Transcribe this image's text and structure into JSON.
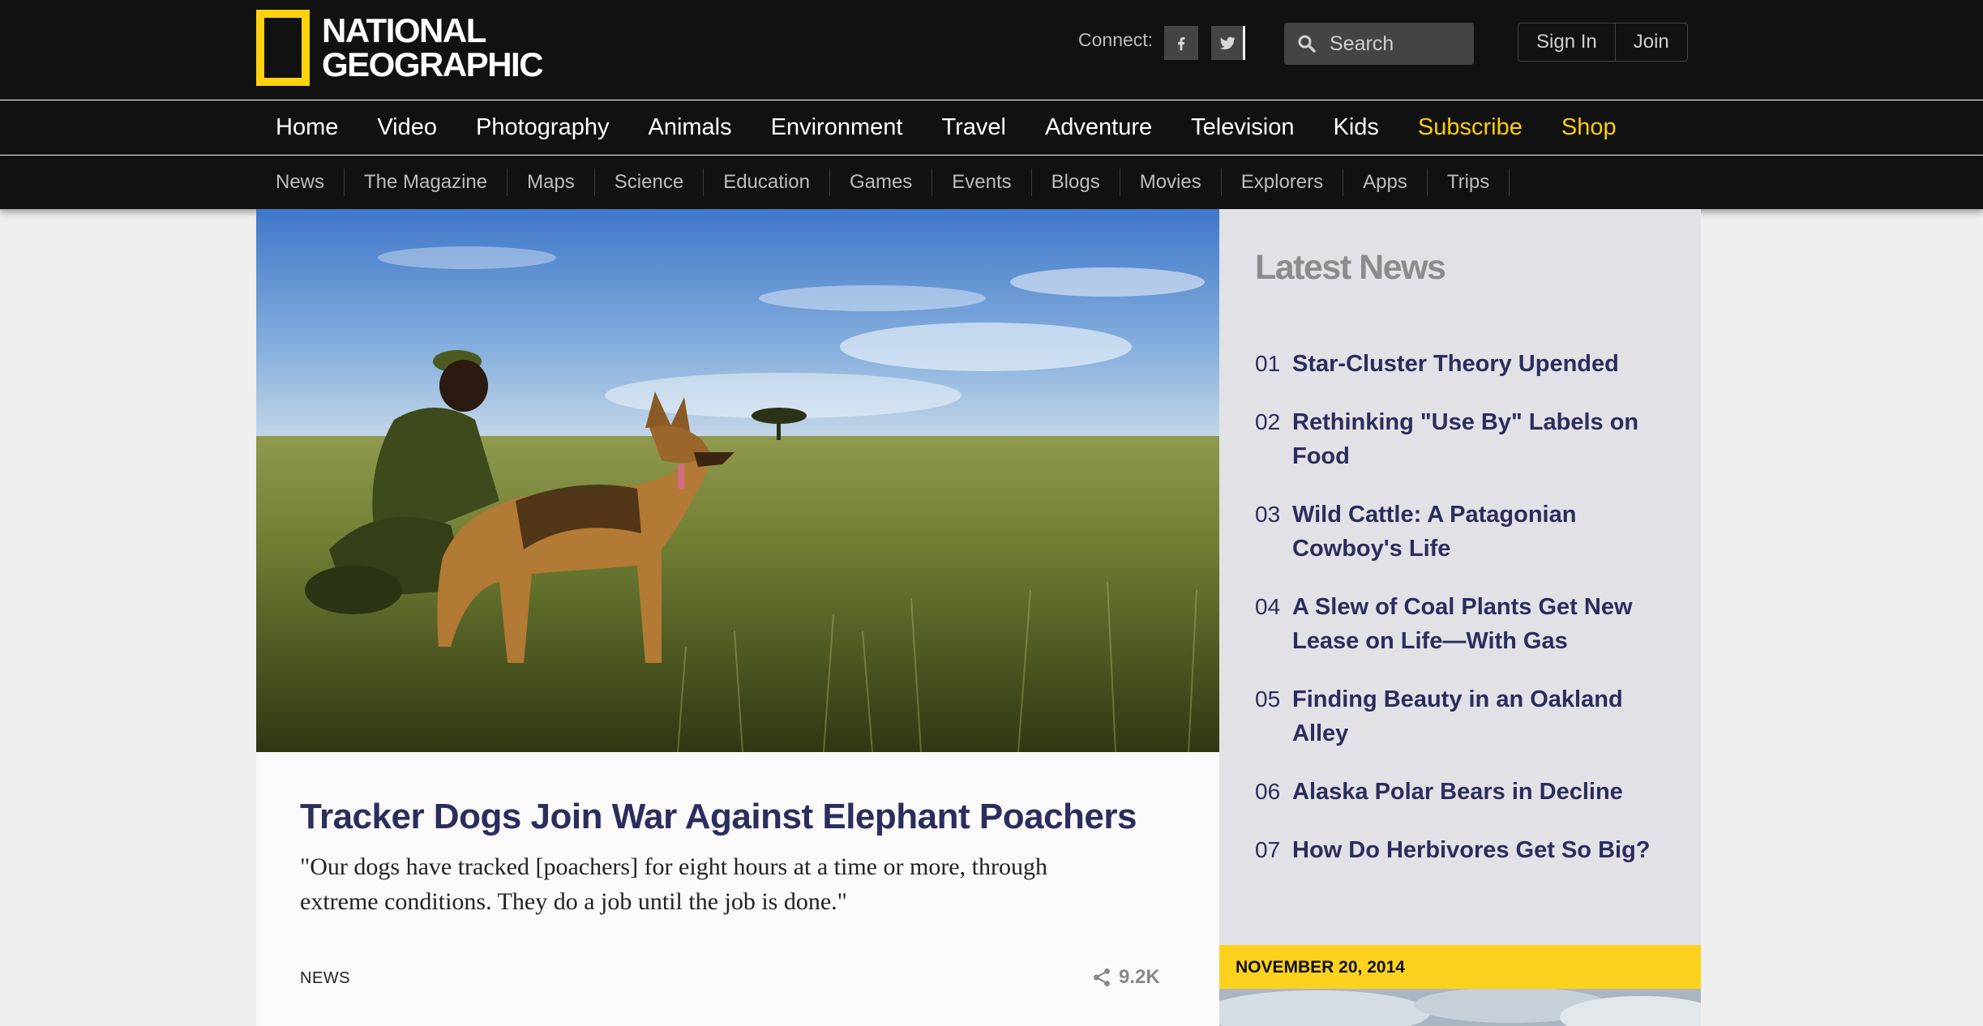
{
  "brand": {
    "line1": "NATIONAL",
    "line2": "GEOGRAPHIC",
    "accent_color": "#ffd10f"
  },
  "header": {
    "connect_label": "Connect:",
    "social": [
      "facebook-icon",
      "twitter-icon"
    ],
    "search_placeholder": "Search",
    "sign_in": "Sign In",
    "join": "Join"
  },
  "nav_primary": [
    "Home",
    "Video",
    "Photography",
    "Animals",
    "Environment",
    "Travel",
    "Adventure",
    "Television",
    "Kids",
    "Subscribe",
    "Shop"
  ],
  "nav_secondary": [
    "News",
    "The Magazine",
    "Maps",
    "Science",
    "Education",
    "Games",
    "Events",
    "Blogs",
    "Movies",
    "Explorers",
    "Apps",
    "Trips"
  ],
  "feature": {
    "title": "Tracker Dogs Join War Against Elephant Poachers",
    "dek": "\"Our dogs have tracked [poachers] for eight hours at a time or more, through extreme conditions. They do a job until the job is done.\"",
    "section": "NEWS",
    "shares": "9.2K"
  },
  "sidebar": {
    "heading": "Latest News",
    "items": [
      {
        "num": "01",
        "title": "Star-Cluster Theory Upended"
      },
      {
        "num": "02",
        "title": "Rethinking \"Use By\" Labels on Food"
      },
      {
        "num": "03",
        "title": "Wild Cattle: A Patagonian Cowboy's Life"
      },
      {
        "num": "04",
        "title": "A Slew of Coal Plants Get New Lease on Life—With Gas"
      },
      {
        "num": "05",
        "title": "Finding Beauty in an Oakland Alley"
      },
      {
        "num": "06",
        "title": "Alaska Polar Bears in Decline"
      },
      {
        "num": "07",
        "title": "How Do Herbivores Get So Big?"
      }
    ],
    "date": "NOVEMBER 20, 2014"
  }
}
